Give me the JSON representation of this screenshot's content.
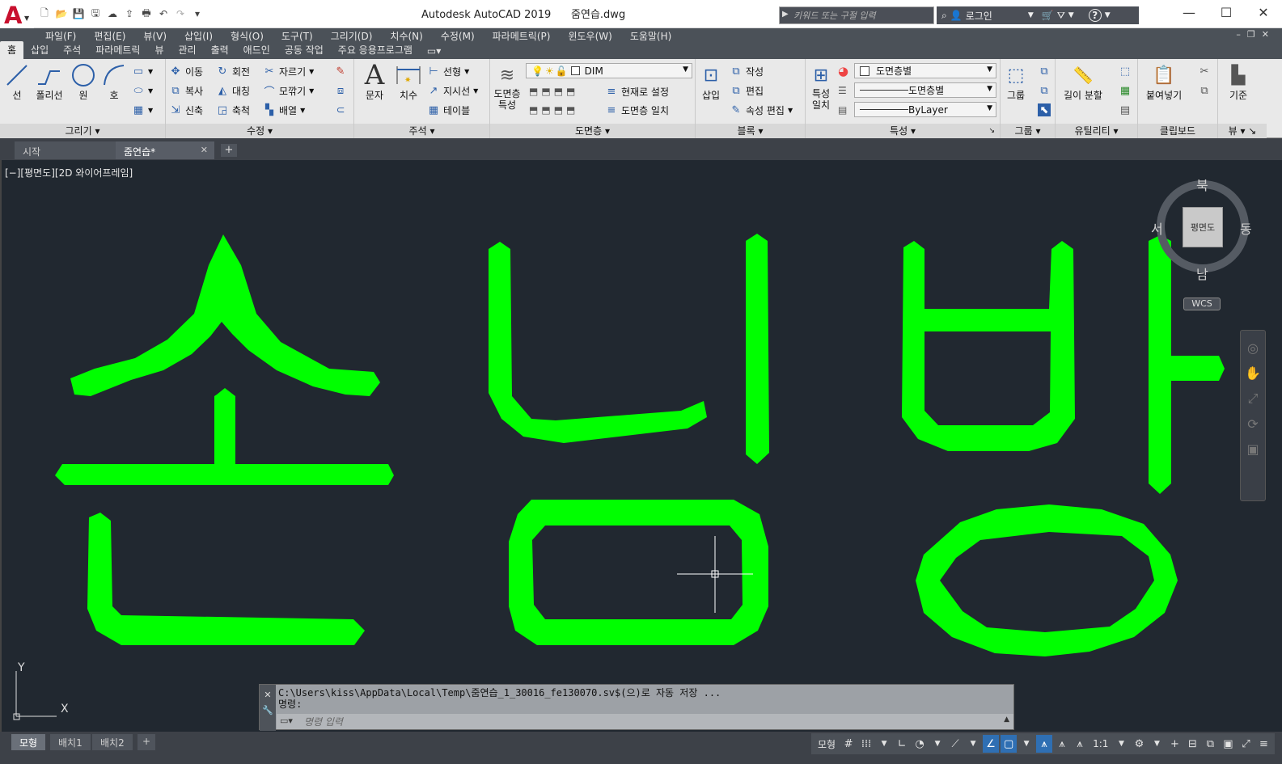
{
  "title": {
    "app": "Autodesk AutoCAD 2019",
    "file": "줌연습.dwg"
  },
  "search": {
    "placeholder": "키워드 또는 구절 입력"
  },
  "header_tools": {
    "login": "로그인",
    "help": "?"
  },
  "menu": [
    "파일(F)",
    "편집(E)",
    "뷰(V)",
    "삽입(I)",
    "형식(O)",
    "도구(T)",
    "그리기(D)",
    "치수(N)",
    "수정(M)",
    "파라메트릭(P)",
    "윈도우(W)",
    "도움말(H)"
  ],
  "ribbon_tabs": [
    "홈",
    "삽입",
    "주석",
    "파라메트릭",
    "뷰",
    "관리",
    "출력",
    "애드인",
    "공동 작업",
    "주요 응용프로그램"
  ],
  "ribbon": {
    "draw": {
      "title": "그리기",
      "line": "선",
      "polyline": "폴리선",
      "circle": "원",
      "arc": "호"
    },
    "modify": {
      "title": "수정",
      "move": "이동",
      "rotate": "회전",
      "trim": "자르기",
      "copy": "복사",
      "mirror": "대칭",
      "fillet": "모깎기",
      "stretch": "신축",
      "scale": "축척",
      "array": "배열"
    },
    "annotation": {
      "title": "주석",
      "text": "문자",
      "dimension": "치수",
      "linear": "선형",
      "leader": "지시선",
      "table": "테이블"
    },
    "layers": {
      "title": "도면층",
      "props": "도면층\n특성",
      "current_layer": "DIM",
      "make_current": "현재로 설정",
      "match_layer": "도면층 일치"
    },
    "block": {
      "title": "블록",
      "insert": "삽입",
      "create": "작성",
      "edit": "편집",
      "attr_edit": "속성 편집"
    },
    "properties": {
      "title": "특성",
      "match": "특성\n일치",
      "color": "도면층별",
      "linetype": "도면층별",
      "lineweight": "ByLayer"
    },
    "groups": {
      "title": "그룹",
      "group": "그룹"
    },
    "utilities": {
      "title": "유틸리티",
      "measure": "길이 분할"
    },
    "clipboard": {
      "title": "클립보드",
      "paste": "붙여넣기"
    },
    "view": {
      "title": "뷰",
      "base": "기준"
    }
  },
  "doc_tabs": {
    "start": "시작",
    "active": "줌연습*"
  },
  "viewport_label": "[−][평면도][2D 와이어프레임]",
  "viewcube": {
    "north": "북",
    "south": "남",
    "east": "동",
    "west": "서",
    "face": "평면도",
    "wcs": "WCS"
  },
  "ucs": {
    "x": "X",
    "y": "Y"
  },
  "command": {
    "history": [
      "C:\\Users\\kiss\\AppData\\Local\\Temp\\줌연습_1_30016_fe130070.sv$(으)로 자동 저장 ...",
      "명령:"
    ],
    "placeholder": "명령 입력"
  },
  "layout_tabs": [
    "모형",
    "배치1",
    "배치2"
  ],
  "status": {
    "model": "모형",
    "scale": "1:1"
  },
  "colors": {
    "drawing": "#00ff00",
    "canvas": "#212830"
  }
}
